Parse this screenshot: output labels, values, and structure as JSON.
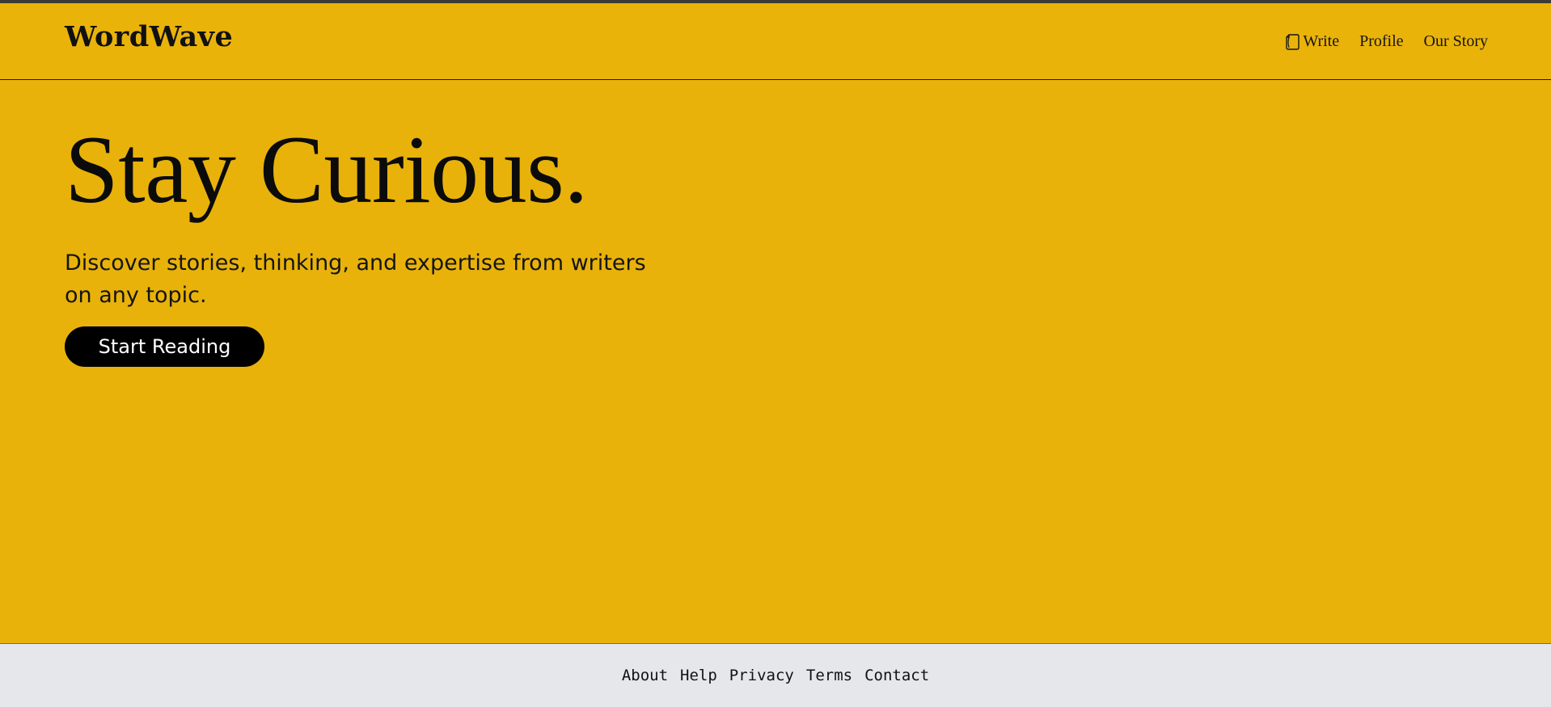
{
  "header": {
    "logo": "WordWave",
    "nav": [
      {
        "label": "Write",
        "icon": "write-icon"
      },
      {
        "label": "Profile"
      },
      {
        "label": "Our Story"
      }
    ]
  },
  "hero": {
    "title": "Stay Curious.",
    "subtitle": "Discover stories, thinking, and expertise from writers on any topic.",
    "cta_label": "Start Reading"
  },
  "footer": {
    "links": [
      "About",
      "Help",
      "Privacy",
      "Terms",
      "Contact"
    ]
  },
  "colors": {
    "background": "#e8b20a",
    "text": "#111111",
    "button_bg": "#000000",
    "button_text": "#ffffff",
    "footer_bg": "#e6e7eb"
  }
}
